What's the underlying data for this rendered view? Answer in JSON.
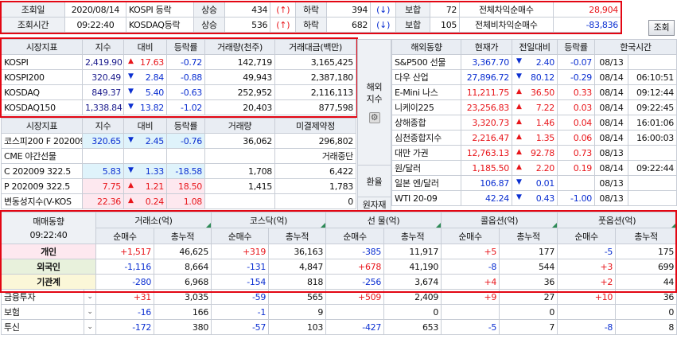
{
  "top_bar": {
    "query_date_label": "조회일",
    "query_date": "2020/08/14",
    "query_time_label": "조회시간",
    "query_time": "09:22:40",
    "kospi_label": "KOSPI 등락",
    "kosdaq_label": "KOSDAQ등락",
    "rise_label": "상승",
    "fall_label": "하락",
    "flat_label": "보합",
    "kospi_rise": "434",
    "kospi_fall": "394",
    "kospi_flat": "72",
    "kosdaq_rise": "536",
    "kosdaq_fall": "682",
    "kosdaq_flat": "105",
    "up_arrow": "(↑)",
    "down_arrow": "(↓)",
    "total_arb_label": "전체차익순매수",
    "total_arb_value": "28,904",
    "total_nonarb_label": "전체비차익순매수",
    "total_nonarb_value": "-83,836",
    "query_button": "조회"
  },
  "market_index": {
    "headers": [
      "시장지표",
      "지수",
      "대비",
      "등락률",
      "거래량(천주)",
      "거래대금(백만)"
    ],
    "rows": [
      {
        "name": "KOSPI",
        "index": "2,419.90",
        "change": "17.63",
        "dir": "up",
        "rate": "-0.72",
        "volume": "142,719",
        "amount": "3,165,425"
      },
      {
        "name": "KOSPI200",
        "index": "320.49",
        "change": "2.84",
        "dir": "down",
        "rate": "-0.88",
        "volume": "49,943",
        "amount": "2,387,180"
      },
      {
        "name": "KOSDAQ",
        "index": "849.37",
        "change": "5.40",
        "dir": "down",
        "rate": "-0.63",
        "volume": "252,952",
        "amount": "2,116,113"
      },
      {
        "name": "KOSDAQ150",
        "index": "1,338.84",
        "change": "13.82",
        "dir": "down",
        "rate": "-1.02",
        "volume": "20,403",
        "amount": "877,598"
      }
    ]
  },
  "derivatives": {
    "headers": [
      "시장지표",
      "지수",
      "대비",
      "등락률",
      "거래량",
      "미결제약정"
    ],
    "rows": [
      {
        "name": "코스피200 F 202009",
        "index": "320.65",
        "change": "2.45",
        "dir": "down",
        "rate": "-0.76",
        "volume": "36,062",
        "oi": "296,802",
        "hl": "cy"
      },
      {
        "name": "CME 야간선물",
        "index": "",
        "change": "",
        "dir": "",
        "rate": "",
        "volume": "",
        "oi": "거래중단",
        "hl": ""
      },
      {
        "name": "C 202009 322.5",
        "index": "5.83",
        "change": "1.33",
        "dir": "down",
        "rate": "-18.58",
        "volume": "1,708",
        "oi": "6,422",
        "hl": "cy"
      },
      {
        "name": "P 202009 322.5",
        "index": "7.75",
        "change": "1.21",
        "dir": "up",
        "rate": "18.50",
        "volume": "1,415",
        "oi": "1,783",
        "hl": "pk"
      },
      {
        "name": "변동성지수(V-KOS",
        "index": "22.36",
        "change": "0.24",
        "dir": "up",
        "rate": "1.08",
        "volume": "",
        "oi": "0",
        "hl": "pk"
      }
    ]
  },
  "side_labels": {
    "overseas_indices": "해외지수",
    "fx": "환율",
    "commodities": "원자재"
  },
  "overseas": {
    "headers": [
      "해외동향",
      "현재가",
      "전일대비",
      "등락률",
      "한국시간"
    ],
    "rows": [
      {
        "name": "S&P500 선물",
        "price": "3,367.70",
        "change": "2.40",
        "dir": "down",
        "rate": "-0.07",
        "date": "08/13",
        "time": ""
      },
      {
        "name": "다우 산업",
        "price": "27,896.72",
        "change": "80.12",
        "dir": "down",
        "rate": "-0.29",
        "date": "08/14",
        "time": "06:10:51"
      },
      {
        "name": "E-Mini 나스",
        "price": "11,211.75",
        "change": "36.50",
        "dir": "up",
        "rate": "0.33",
        "date": "08/14",
        "time": "09:12:44"
      },
      {
        "name": "니케이225",
        "price": "23,256.83",
        "change": "7.22",
        "dir": "up",
        "rate": "0.03",
        "date": "08/14",
        "time": "09:22:45"
      },
      {
        "name": "상해종합",
        "price": "3,320.73",
        "change": "1.46",
        "dir": "up",
        "rate": "0.04",
        "date": "08/14",
        "time": "16:01:06"
      },
      {
        "name": "심천종합지수",
        "price": "2,216.47",
        "change": "1.35",
        "dir": "up",
        "rate": "0.06",
        "date": "08/14",
        "time": "16:00:03"
      },
      {
        "name": "대만 가권",
        "price": "12,763.13",
        "change": "92.78",
        "dir": "up",
        "rate": "0.73",
        "date": "08/13",
        "time": ""
      },
      {
        "name": "원/달러",
        "price": "1,185.50",
        "change": "2.20",
        "dir": "up",
        "rate": "0.19",
        "date": "08/14",
        "time": "09:22:44"
      },
      {
        "name": "일본 엔/달러",
        "price": "106.87",
        "change": "0.01",
        "dir": "down",
        "rate": "",
        "date": "08/13",
        "time": ""
      },
      {
        "name": "WTI 20-09",
        "price": "42.24",
        "change": "0.43",
        "dir": "down",
        "rate": "-1.00",
        "date": "08/13",
        "time": ""
      }
    ]
  },
  "investor": {
    "title": "매매동향",
    "time": "09:22:40",
    "groups": [
      "거래소(억)",
      "코스닥(억)",
      "선  물(억)",
      "콜옵션(억)",
      "풋옵션(억)"
    ],
    "sub_headers": [
      "순매수",
      "총누적"
    ],
    "rows": [
      {
        "name": "개인",
        "bg": "#fde8ef",
        "bold": true,
        "dropdown": false,
        "cells": [
          [
            "+1,517",
            "red"
          ],
          [
            "46,625",
            ""
          ],
          [
            "+319",
            "red"
          ],
          [
            "36,163",
            ""
          ],
          [
            "-385",
            "blue"
          ],
          [
            "11,917",
            ""
          ],
          [
            "+5",
            "red"
          ],
          [
            "177",
            ""
          ],
          [
            "-5",
            "blue"
          ],
          [
            "175",
            ""
          ]
        ]
      },
      {
        "name": "외국인",
        "bg": "#e8f1dc",
        "bold": true,
        "dropdown": false,
        "cells": [
          [
            "-1,116",
            "blue"
          ],
          [
            "8,664",
            ""
          ],
          [
            "-131",
            "blue"
          ],
          [
            "4,847",
            ""
          ],
          [
            "+678",
            "red"
          ],
          [
            "41,190",
            ""
          ],
          [
            "-8",
            "blue"
          ],
          [
            "544",
            ""
          ],
          [
            "+3",
            "red"
          ],
          [
            "699",
            ""
          ]
        ]
      },
      {
        "name": "기관계",
        "bg": "#fbf7d8",
        "bold": true,
        "dropdown": false,
        "cells": [
          [
            "-280",
            "blue"
          ],
          [
            "6,968",
            ""
          ],
          [
            "-154",
            "blue"
          ],
          [
            "818",
            ""
          ],
          [
            "-256",
            "blue"
          ],
          [
            "3,674",
            ""
          ],
          [
            "+4",
            "red"
          ],
          [
            "36",
            ""
          ],
          [
            "+2",
            "red"
          ],
          [
            "44",
            ""
          ]
        ]
      },
      {
        "name": "금융투자",
        "bg": "#ffffff",
        "bold": false,
        "dropdown": true,
        "cells": [
          [
            "+31",
            "red"
          ],
          [
            "3,035",
            ""
          ],
          [
            "-59",
            "blue"
          ],
          [
            "565",
            ""
          ],
          [
            "+509",
            "red"
          ],
          [
            "2,409",
            ""
          ],
          [
            "+9",
            "red"
          ],
          [
            "27",
            ""
          ],
          [
            "+10",
            "red"
          ],
          [
            "36",
            ""
          ]
        ]
      },
      {
        "name": "보험",
        "bg": "#ffffff",
        "bold": false,
        "dropdown": true,
        "cells": [
          [
            "-16",
            "blue"
          ],
          [
            "166",
            ""
          ],
          [
            "-1",
            "blue"
          ],
          [
            "9",
            ""
          ],
          [
            "",
            ""
          ],
          [
            "0",
            ""
          ],
          [
            "",
            ""
          ],
          [
            "0",
            ""
          ],
          [
            "",
            ""
          ],
          [
            "0",
            ""
          ]
        ]
      },
      {
        "name": "투신",
        "bg": "#ffffff",
        "bold": false,
        "dropdown": true,
        "cells": [
          [
            "-172",
            "blue"
          ],
          [
            "380",
            ""
          ],
          [
            "-57",
            "blue"
          ],
          [
            "103",
            ""
          ],
          [
            "-427",
            "blue"
          ],
          [
            "653",
            ""
          ],
          [
            "-5",
            "blue"
          ],
          [
            "7",
            ""
          ],
          [
            "-8",
            "blue"
          ],
          [
            "8",
            ""
          ]
        ]
      }
    ]
  },
  "colors": {
    "highlight_frame": "#e30613",
    "up": "#e8161b",
    "down": "#0b2fd1"
  }
}
